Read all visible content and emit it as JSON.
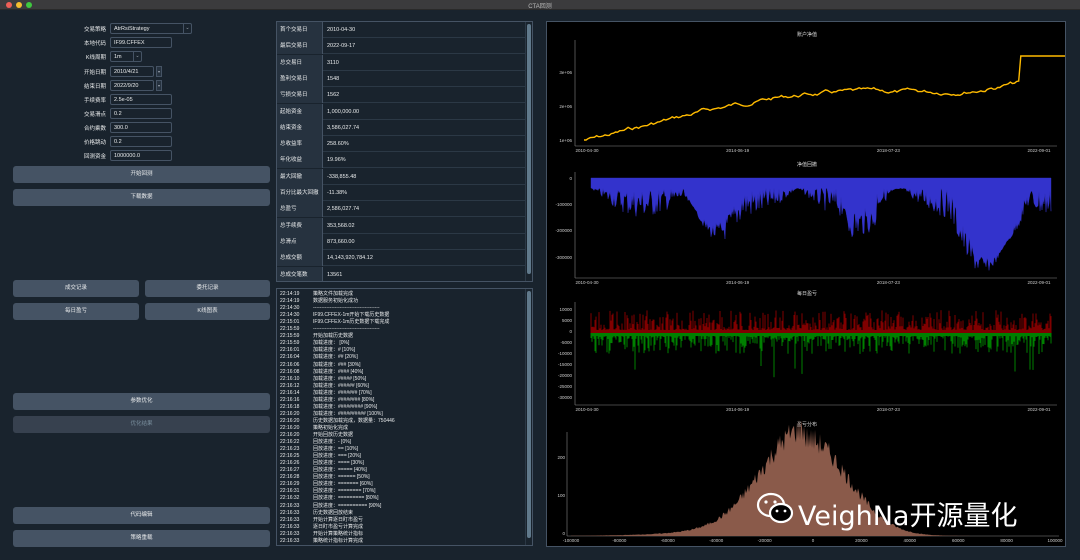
{
  "window": {
    "title": "CTA回测"
  },
  "form": {
    "strategy_label": "交易策略",
    "strategy_value": "AtrRsiStrategy",
    "symbol_label": "本地代码",
    "symbol_value": "IF99.CFFEX",
    "interval_label": "K线周期",
    "interval_value": "1m",
    "start_label": "开始日期",
    "start_value": "2010/4/21",
    "end_label": "结束日期",
    "end_value": "2022/9/20",
    "fee_label": "手续费率",
    "fee_value": "2.5e-05",
    "slippage_label": "交易滑点",
    "slippage_value": "0.2",
    "size_label": "合约乘数",
    "size_value": "300.0",
    "pricetick_label": "价格跳动",
    "pricetick_value": "0.2",
    "capital_label": "回测资金",
    "capital_value": "1000000.0"
  },
  "buttons": {
    "start_backtest": "开始回测",
    "download_data": "下载数据",
    "trade_records": "成交记录",
    "order_records": "委托记录",
    "daily_pnl": "每日盈亏",
    "candle_chart": "K线图表",
    "optimize": "参数优化",
    "optimize_result": "优化结果",
    "edit_code": "代码编辑",
    "reload_strategy": "策略重载"
  },
  "stats": [
    {
      "k": "首个交易日",
      "v": "2010-04-30"
    },
    {
      "k": "最后交易日",
      "v": "2022-09-17"
    },
    {
      "k": "总交易日",
      "v": "3110"
    },
    {
      "k": "盈利交易日",
      "v": "1548"
    },
    {
      "k": "亏损交易日",
      "v": "1562"
    },
    {
      "k": "起始资金",
      "v": "1,000,000.00"
    },
    {
      "k": "结束资金",
      "v": "3,586,027.74"
    },
    {
      "k": "总收益率",
      "v": "258.60%"
    },
    {
      "k": "年化收益",
      "v": "19.96%"
    },
    {
      "k": "最大回撤",
      "v": "-338,855.48"
    },
    {
      "k": "百分比最大回撤",
      "v": "-11.38%"
    },
    {
      "k": "总盈亏",
      "v": "2,586,027.74"
    },
    {
      "k": "总手续费",
      "v": "353,568.02"
    },
    {
      "k": "总滑点",
      "v": "873,660.00"
    },
    {
      "k": "总成交额",
      "v": "14,143,920,784.12"
    },
    {
      "k": "总成交笔数",
      "v": "13561"
    },
    {
      "k": "日均盈亏",
      "v": "831.52"
    },
    {
      "k": "日均手续费",
      "v": "113.71"
    },
    {
      "k": "日均滑点",
      "v": "281.63"
    },
    {
      "k": "日均成交额",
      "v": "4,548,527.58"
    },
    {
      "k": "日均成交笔数",
      "v": ""
    }
  ],
  "log": [
    [
      "22:14:19",
      "策略文件加载完成"
    ],
    [
      "22:14:19",
      "数据服务初始化成功"
    ],
    [
      "22:14:30",
      "----------------------------------------"
    ],
    [
      "22:14:30",
      "IF99.CFFEX-1m开始下载历史数据"
    ],
    [
      "22:15:01",
      "IF99.CFFEX-1m历史数据下载完成"
    ],
    [
      "22:15:59",
      "----------------------------------------"
    ],
    [
      "22:15:59",
      "开始加载历史数据"
    ],
    [
      "22:15:59",
      "加载进度： [0%]"
    ],
    [
      "22:16:01",
      "加载进度：# [10%]"
    ],
    [
      "22:16:04",
      "加载进度：## [20%]"
    ],
    [
      "22:16:06",
      "加载进度：### [30%]"
    ],
    [
      "22:16:08",
      "加载进度：#### [40%]"
    ],
    [
      "22:16:10",
      "加载进度：##### [50%]"
    ],
    [
      "22:16:12",
      "加载进度：###### [60%]"
    ],
    [
      "22:16:14",
      "加载进度：####### [70%]"
    ],
    [
      "22:16:16",
      "加载进度：######## [80%]"
    ],
    [
      "22:16:18",
      "加载进度：######### [90%]"
    ],
    [
      "22:16:20",
      "加载进度：########## [100%]"
    ],
    [
      "22:16:20",
      "历史数据加载完成，数据量：750446"
    ],
    [
      "22:16:20",
      "策略初始化完成"
    ],
    [
      "22:16:20",
      "开始回放历史数据"
    ],
    [
      "22:16:22",
      "回放进度：- [0%]"
    ],
    [
      "22:16:23",
      "回放进度：== [10%]"
    ],
    [
      "22:16:25",
      "回放进度：=== [20%]"
    ],
    [
      "22:16:26",
      "回放进度：==== [30%]"
    ],
    [
      "22:16:27",
      "回放进度：===== [40%]"
    ],
    [
      "22:16:28",
      "回放进度：====== [50%]"
    ],
    [
      "22:16:29",
      "回放进度：======= [60%]"
    ],
    [
      "22:16:31",
      "回放进度：======== [70%]"
    ],
    [
      "22:16:32",
      "回放进度：========= [80%]"
    ],
    [
      "22:16:33",
      "回放进度：========== [90%]"
    ],
    [
      "22:16:33",
      "历史数据回放结束"
    ],
    [
      "22:16:33",
      "开始计算逐日盯市盈亏"
    ],
    [
      "22:16:33",
      "逐日盯市盈亏计算完成"
    ],
    [
      "22:16:33",
      "开始计算策略统计指标"
    ],
    [
      "22:16:33",
      "策略统计指标计算完成"
    ]
  ],
  "charts": {
    "balance": {
      "title": "账户净值",
      "yticks": [
        "1e+06",
        "2e+06",
        "3e+06"
      ],
      "xticks": [
        "2010-04-30",
        "2014-06-19",
        "2018-07-23",
        "2022-09-01"
      ],
      "color": "#ffbb00"
    },
    "drawdown": {
      "title": "净值回撤",
      "yticks": [
        "0",
        "-100000",
        "-200000",
        "-300000"
      ],
      "xticks": [
        "2010-04-30",
        "2014-06-19",
        "2018-07-23",
        "2022-09-01"
      ],
      "color": "#3333cc"
    },
    "pnl": {
      "title": "每日盈亏",
      "yticks": [
        "10000",
        "5000",
        "0",
        "-5000",
        "-10000",
        "-15000",
        "-20000",
        "-25000",
        "-30000"
      ],
      "xticks": [
        "2010-04-30",
        "2014-06-19",
        "2018-07-23",
        "2022-09-01"
      ],
      "pos_color": "#ff0000",
      "neg_color": "#00ff00"
    },
    "distribution": {
      "title": "盈亏分布",
      "yticks": [
        "200",
        "100",
        "0"
      ],
      "xticks": [
        "-100000",
        "-80000",
        "-60000",
        "-40000",
        "-20000",
        "0",
        "20000",
        "40000",
        "60000",
        "80000",
        "100000"
      ],
      "color": "#8a5a4a"
    }
  },
  "watermark": {
    "text": "VeighNa开源量化"
  },
  "icons": {
    "watermark_logo": "wechat-icon"
  }
}
